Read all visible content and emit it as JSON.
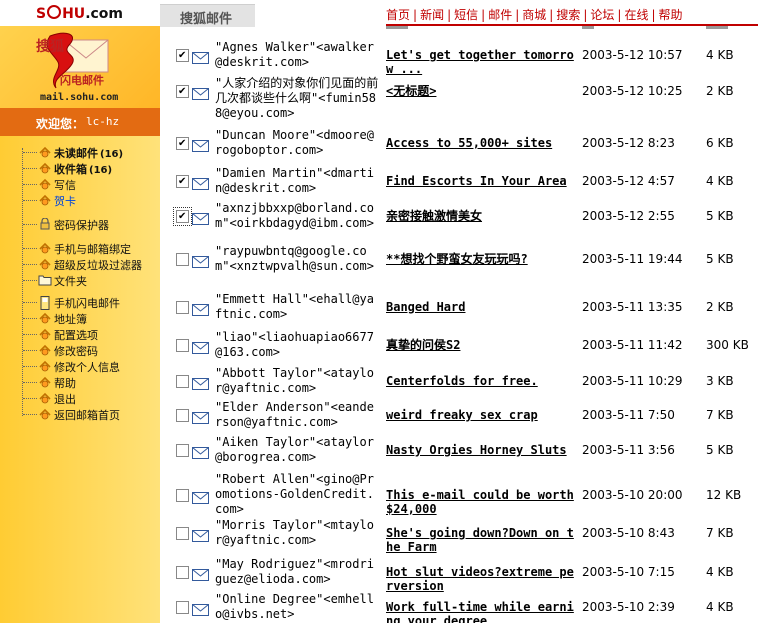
{
  "topbar": {
    "logo_sohu": "S",
    "logo_rest": "HU",
    "logo_dotcom": ".com",
    "tab_label": "搜狐邮件",
    "nav": [
      "首页",
      "新闻",
      "短信",
      "邮件",
      "商城",
      "搜索",
      "论坛",
      "在线",
      "帮助"
    ]
  },
  "brand": {
    "name": "搜狐",
    "mail": "闪电邮件",
    "url": "mail.sohu.com"
  },
  "welcome": {
    "label": "欢迎您：",
    "user": "lc-hz"
  },
  "menu": [
    {
      "label": "未读邮件",
      "count": "(16)",
      "style": "bold",
      "icon": "envelope-icon"
    },
    {
      "label": "收件箱",
      "count": "(16)",
      "style": "bold",
      "icon": "envelope-icon"
    },
    {
      "label": "写信",
      "count": "",
      "style": "",
      "icon": "envelope-icon"
    },
    {
      "label": "贺卡",
      "count": "",
      "style": "blue",
      "icon": "envelope-icon"
    },
    {
      "label": "密码保护器",
      "count": "",
      "style": "",
      "icon": "lock-icon"
    },
    {
      "label": "手机与邮箱绑定",
      "count": "",
      "style": "",
      "icon": "envelope-icon"
    },
    {
      "label": "超级反垃圾过滤器",
      "count": "",
      "style": "",
      "icon": "envelope-icon"
    },
    {
      "label": "文件夹",
      "count": "",
      "style": "",
      "icon": "folder-icon"
    },
    {
      "label": "手机闪电邮件",
      "count": "",
      "style": "",
      "icon": "phone-icon"
    },
    {
      "label": "地址簿",
      "count": "",
      "style": "",
      "icon": "envelope-icon"
    },
    {
      "label": "配置选项",
      "count": "",
      "style": "",
      "icon": "envelope-icon"
    },
    {
      "label": "修改密码",
      "count": "",
      "style": "",
      "icon": "envelope-icon"
    },
    {
      "label": "修改个人信息",
      "count": "",
      "style": "",
      "icon": "envelope-icon"
    },
    {
      "label": "帮助",
      "count": "",
      "style": "",
      "icon": "envelope-icon"
    },
    {
      "label": "退出",
      "count": "",
      "style": "",
      "icon": "envelope-icon"
    },
    {
      "label": "返回邮箱首页",
      "count": "",
      "style": "",
      "icon": "envelope-icon"
    }
  ],
  "messages": [
    {
      "checked": true,
      "from": "\"Agnes Walker\"<awalker@deskrit.com>",
      "subject": "Let's get together tomorrow ...",
      "date": "2003-5-12 10:57",
      "size": "4 KB"
    },
    {
      "checked": true,
      "from": "\"人家介绍的对象你们见面的前几次都谈些什么啊\"<fumin588@eyou.com>",
      "subject": "<无标题>",
      "date": "2003-5-12 10:25",
      "size": "2 KB"
    },
    {
      "checked": true,
      "from": "\"Duncan Moore\"<dmoore@rogoboptor.com>",
      "subject": "Access to 55,000+ sites",
      "date": "2003-5-12 8:23",
      "size": "6 KB"
    },
    {
      "checked": true,
      "from": "\"Damien Martin\"<dmartin@deskrit.com>",
      "subject": "Find Escorts In  Your Area",
      "date": "2003-5-12 4:57",
      "size": "4 KB"
    },
    {
      "checked": true,
      "from": "\"axnzjbbxxp@borland.com\"<oirkbdagyd@ibm.com>",
      "subject": "亲密接触激情美女",
      "date": "2003-5-12 2:55",
      "size": "5 KB"
    },
    {
      "checked": false,
      "from": "\"raypuwbntq@google.com\"<xnztwpvalh@sun.com>",
      "subject": "**想找个野蛮女友玩玩吗?",
      "date": "2003-5-11 19:44",
      "size": "5 KB"
    },
    {
      "checked": false,
      "from": "\"Emmett Hall\"<ehall@yaftnic.com>",
      "subject": "Banged Hard",
      "date": "2003-5-11 13:35",
      "size": "2 KB"
    },
    {
      "checked": false,
      "from": "\"liao\"<liaohuapiao6677@163.com>",
      "subject": "真挚的问侯S2",
      "date": "2003-5-11 11:42",
      "size": "300 KB"
    },
    {
      "checked": false,
      "from": "\"Abbott Taylor\"<ataylor@yaftnic.com>",
      "subject": "Centerfolds for  free.",
      "date": "2003-5-11 10:29",
      "size": "3 KB"
    },
    {
      "checked": false,
      "from": "\"Elder Anderson\"<eanderson@yaftnic.com>",
      "subject": "weird freaky sex crap",
      "date": "2003-5-11 7:50",
      "size": "7 KB"
    },
    {
      "checked": false,
      "from": "\"Aiken Taylor\"<ataylor@borogrea.com>",
      "subject": "Nasty Orgies Horney Sluts",
      "date": "2003-5-11 3:56",
      "size": "5 KB"
    },
    {
      "checked": false,
      "from": "\"Robert Allen\"<gino@Promotions-GoldenCredit.com>",
      "subject": "This e-mail could be worth $24,000",
      "date": "2003-5-10 20:00",
      "size": "12 KB"
    },
    {
      "checked": false,
      "from": "\"Morris Taylor\"<mtaylor@yaftnic.com>",
      "subject": "She's going down?Down on the Farm",
      "date": "2003-5-10 8:43",
      "size": "7 KB"
    },
    {
      "checked": false,
      "from": "\"May Rodriguez\"<mrodriguez@elioda.com>",
      "subject": "Hot slut videos?extreme perversion",
      "date": "2003-5-10 7:15",
      "size": "4 KB"
    },
    {
      "checked": false,
      "from": "\"Online Degree\"<emhello@ivbs.net>",
      "subject": "Work full-time while earning your degree",
      "date": "2003-5-10 2:39",
      "size": "4 KB"
    }
  ],
  "colors": {
    "accent": "#c00000",
    "sidebar": "#ffcc33",
    "welcome_bar": "#e36b12"
  }
}
